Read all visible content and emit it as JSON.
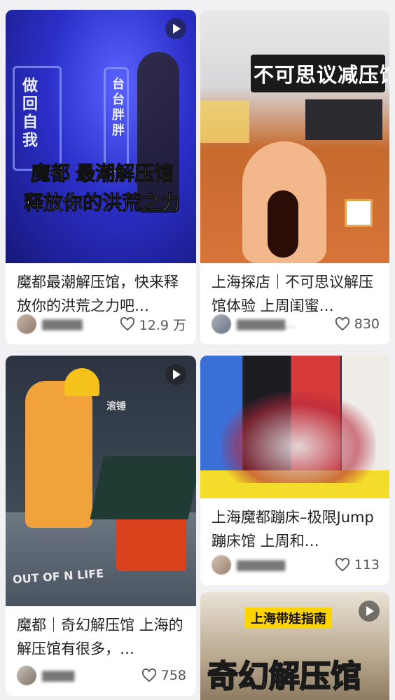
{
  "feed": {
    "cards": [
      {
        "cover_lines": [
          "魔都",
          "最潮解压馆",
          "释放你的洪荒之力"
        ],
        "cover_side_texts": [
          "做回自我",
          "台台胖胖"
        ],
        "title": "魔都最潮解压馆，快来释放你的洪荒之力吧…",
        "likes": "12.9 万",
        "is_video": true
      },
      {
        "cover_sign": "不可思议减压馆",
        "title": "上海探店｜不可思议解压馆体验 上周闺蜜…",
        "likes": "830",
        "is_video": false
      },
      {
        "cover_lines": [
          "滚锤",
          "OUT OF",
          "LIFE"
        ],
        "title": "魔都｜奇幻解压馆 上海的解压馆有很多，…",
        "likes": "758",
        "is_video": true
      },
      {
        "title": "上海魔都蹦床–极限Jump蹦床馆 上周和…",
        "likes": "113",
        "is_video": false
      },
      {
        "cover_lines": [
          "上海带娃指南",
          "奇幻解压馆"
        ],
        "is_video": true
      }
    ]
  },
  "colors": {
    "accent_yellow": "#ffd400",
    "background": "#f1f1f3",
    "card": "#ffffff"
  }
}
